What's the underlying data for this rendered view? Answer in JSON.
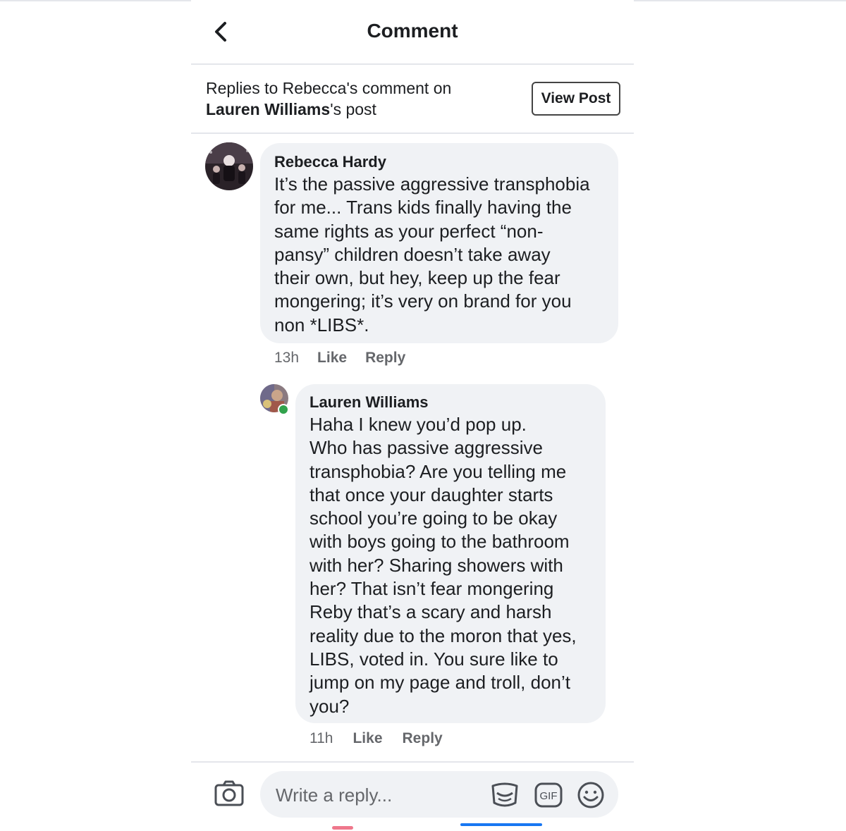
{
  "header": {
    "title": "Comment"
  },
  "context": {
    "line1": "Replies to Rebecca's comment on",
    "post_owner": "Lauren Williams",
    "post_suffix": "'s post",
    "view_post_label": "View Post"
  },
  "comments": [
    {
      "author": "Rebecca Hardy",
      "text": "It’s the passive aggressive transphobia\nfor me... Trans kids finally having the\nsame rights as your perfect “non-\npansy” children doesn’t take away\ntheir own, but hey, keep up the fear\nmongering; it’s very on brand for you\nnon *LIBS*.",
      "time": "13h",
      "like_label": "Like",
      "reply_label": "Reply"
    },
    {
      "author": "Lauren Williams",
      "text": "Haha I knew you’d pop up.\nWho has passive aggressive\ntransphobia? Are you telling me\nthat once your daughter starts\nschool you’re going to be okay\nwith boys going to the bathroom\nwith her? Sharing showers with\nher? That isn’t fear mongering\nReby that’s a scary and harsh\nreality due to the moron that yes,\nLIBS, voted in. You sure like to\njump on my page and troll, don’t\nyou?",
      "time": "11h",
      "like_label": "Like",
      "reply_label": "Reply"
    }
  ],
  "composer": {
    "placeholder": "Write a reply...",
    "icons": [
      "camera-icon",
      "sticker-icon",
      "gif-icon",
      "emoji-icon"
    ],
    "gif_label": "GIF"
  },
  "colors": {
    "bubble": "#f0f2f5",
    "meta_text": "#65676b",
    "online": "#31a24c",
    "accent": "#1877f2"
  }
}
